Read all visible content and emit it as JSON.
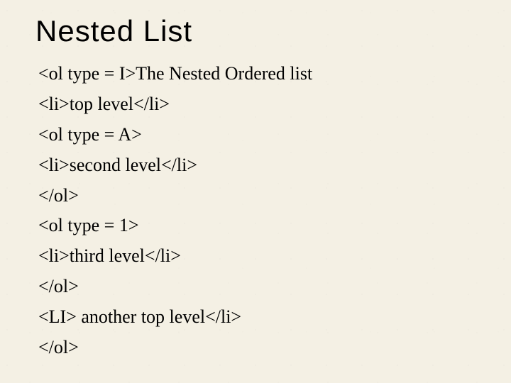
{
  "title": "Nested List",
  "lines": [
    "<ol type = I>The Nested Ordered list",
    "<li>top level</li>",
    "<ol type = A>",
    "<li>second level</li>",
    "</ol>",
    "<ol type = 1>",
    "<li>third level</li>",
    "</ol>",
    "<LI> another top level</li>",
    "</ol>"
  ]
}
